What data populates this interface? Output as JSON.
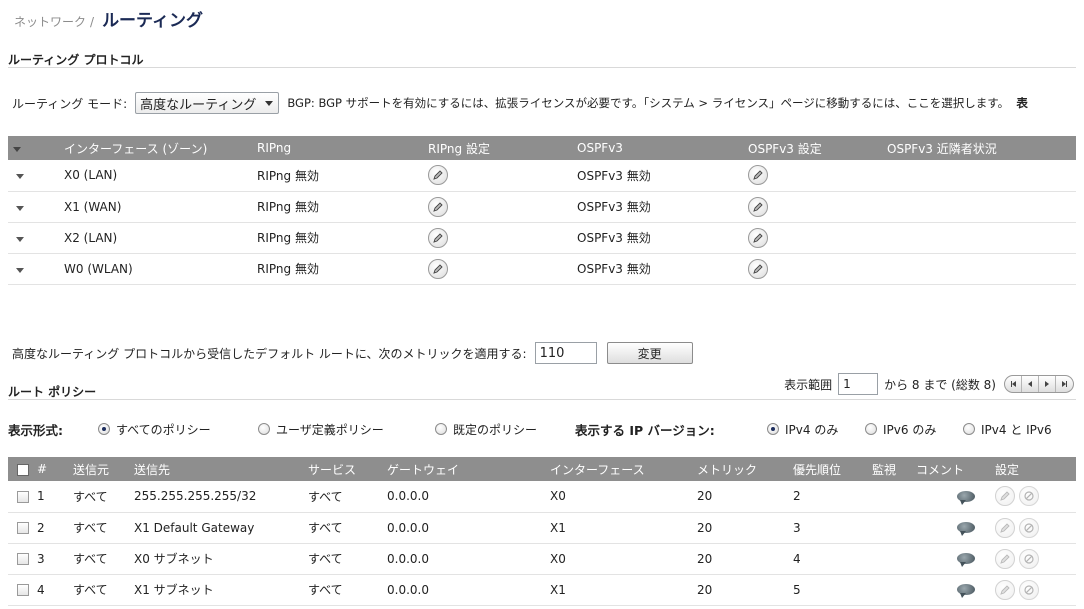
{
  "breadcrumb": {
    "parent": "ネットワーク",
    "separator": "/",
    "current": "ルーティング"
  },
  "routing_protocol": {
    "section_title": "ルーティング プロトコル",
    "mode_label": "ルーティング モード:",
    "mode_selected": "高度なルーティング",
    "bgp_note": "BGP:  BGP サポートを有効にするには、拡張ライセンスが必要です。「システム > ライセンス」ページに移動するには、",
    "bgp_link": "ここを選択します。",
    "bgp_note_tail": "表"
  },
  "interface_table": {
    "headers": [
      "インターフェース (ゾーン)",
      "RIPng",
      "RIPng 設定",
      "OSPFv3",
      "OSPFv3 設定",
      "OSPFv3 近隣者状況"
    ],
    "rows": [
      {
        "interface": "X0 (LAN)",
        "ripng": "RIPng 無効",
        "ospfv3": "OSPFv3 無効"
      },
      {
        "interface": "X1 (WAN)",
        "ripng": "RIPng 無効",
        "ospfv3": "OSPFv3 無効"
      },
      {
        "interface": "X2 (LAN)",
        "ripng": "RIPng 無効",
        "ospfv3": "OSPFv3 無効"
      },
      {
        "interface": "W0 (WLAN)",
        "ripng": "RIPng 無効",
        "ospfv3": "OSPFv3 無効"
      }
    ]
  },
  "default_metric": {
    "label": "高度なルーティング プロトコルから受信したデフォルト ルートに、次のメトリックを適用する:",
    "value": "110",
    "button": "変更"
  },
  "route_policy": {
    "section_title": "ルート ポリシー",
    "pager": {
      "range_label": "表示範囲",
      "start": "1",
      "to_text": "から 8 まで (総数 8)"
    },
    "display_label": "表示形式:",
    "display_options": [
      "すべてのポリシー",
      "ユーザ定義ポリシー",
      "既定のポリシー"
    ],
    "display_selected": "すべてのポリシー",
    "ip_label": "表示する IP バージョン:",
    "ip_options": [
      "IPv4 のみ",
      "IPv6 のみ",
      "IPv4 と IPv6"
    ],
    "ip_selected": "IPv4 のみ",
    "headers": [
      "#",
      "送信元",
      "送信先",
      "サービス",
      "ゲートウェイ",
      "インターフェース",
      "メトリック",
      "優先順位",
      "監視",
      "コメント",
      "設定"
    ],
    "rows": [
      {
        "num": "1",
        "source": "すべて",
        "destination": "255.255.255.255/32",
        "service": "すべて",
        "gateway": "0.0.0.0",
        "interface": "X0",
        "metric": "20",
        "priority": "2"
      },
      {
        "num": "2",
        "source": "すべて",
        "destination": "X1 Default Gateway",
        "service": "すべて",
        "gateway": "0.0.0.0",
        "interface": "X1",
        "metric": "20",
        "priority": "3"
      },
      {
        "num": "3",
        "source": "すべて",
        "destination": "X0 サブネット",
        "service": "すべて",
        "gateway": "0.0.0.0",
        "interface": "X0",
        "metric": "20",
        "priority": "4"
      },
      {
        "num": "4",
        "source": "すべて",
        "destination": "X1 サブネット",
        "service": "すべて",
        "gateway": "0.0.0.0",
        "interface": "X1",
        "metric": "20",
        "priority": "5"
      }
    ]
  },
  "icons": {
    "expand": "expand-arrow-icon",
    "edit": "pencil-edit-icon",
    "delete": "delete-circle-icon",
    "comment": "comment-bubble-icon"
  },
  "colors": {
    "header_bg": "#8e8e8e",
    "title": "#1b2a55",
    "radio_dot": "#1e2f5e"
  }
}
